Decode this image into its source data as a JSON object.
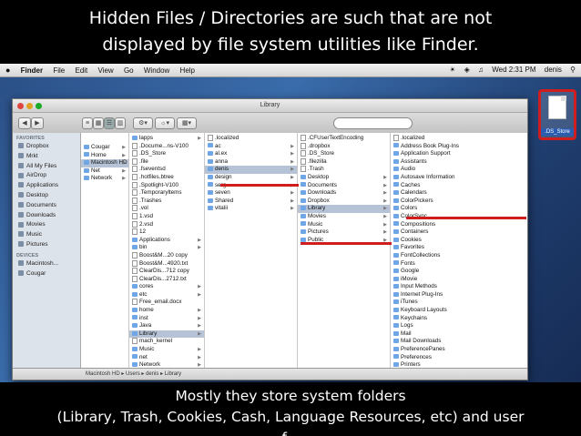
{
  "slide": {
    "title_line1": "Hidden Files / Directories are such that are not",
    "title_line2": "displayed by file system utilities like Finder.",
    "footer_line1": "Mostly they store system folders",
    "footer_line2": "(Library, Trash, Cookies, Cash, Language Resources, etc) and user",
    "footer_line3": "f..."
  },
  "menubar": {
    "apple": "",
    "items": [
      "Finder",
      "File",
      "Edit",
      "View",
      "Go",
      "Window",
      "Help"
    ],
    "clock": "Wed 2:31 PM",
    "user": "denis"
  },
  "desktop_file": {
    "label": ".DS_Store"
  },
  "window": {
    "title": "Library",
    "search_placeholder": "",
    "view_buttons": [
      "≡",
      "▦",
      "☰",
      "▥"
    ],
    "path": [
      "Macintosh HD",
      "Users",
      "denis",
      "Library"
    ]
  },
  "sidebar": {
    "favorites_header": "FAVORITES",
    "favorites": [
      "Dropbox",
      "Mrkt",
      "All My Files",
      "AirDrop",
      "Applications",
      "Desktop",
      "Documents",
      "Downloads",
      "Movies",
      "Music",
      "Pictures"
    ],
    "devices_header": "DEVICES",
    "devices": [
      "Macintosh...",
      "Cougar"
    ]
  },
  "columns": {
    "col1": [
      "Cougar",
      "Home",
      "Macintosh HD",
      "Net",
      "Network"
    ],
    "col2": [
      "lapps",
      ".Docume...ns-V100",
      ".DS_Store",
      ".file",
      ".fseventsd",
      ".hotfiles.btree",
      ".Spotlight-V100",
      ".Temporaryltems",
      ".Trashes",
      ".vol",
      "1.vsd",
      "2.vsd",
      "12",
      "Applications",
      "bin",
      "Boost&M...20 copy",
      "Boost&M...4920.txt",
      "ClearDis...712 copy",
      "ClearDis...2712.txt",
      "cores",
      "etc",
      "Free_email.docx",
      "home",
      "inst",
      "Java",
      "Library",
      "mach_kernel",
      "Music",
      "net",
      "Network"
    ],
    "col3": [
      ".localized",
      "ac",
      "al.ex",
      "anna",
      "denis",
      "design",
      "serg",
      "seven",
      "Shared",
      "vitalii"
    ],
    "col4": [
      ".CFUserTextEncoding",
      ".dropbox",
      ".DS_Store",
      ".filezilla",
      ".Trash",
      "Desktop",
      "Documents",
      "Downloads",
      "Dropbox",
      "Library",
      "Movies",
      "Music",
      "Pictures",
      "Public"
    ],
    "col5": [
      ".localized",
      "Address Book Plug-Ins",
      "Application Support",
      "Assistants",
      "Audio",
      "Autosave Information",
      "Caches",
      "Calendars",
      "ColorPickers",
      "Colors",
      "ColorSync",
      "Compositions",
      "Containers",
      "Cookies",
      "Favorites",
      "FontCollections",
      "Fonts",
      "Google",
      "iMovie",
      "Input Methods",
      "Internet Plug-Ins",
      "iTunes",
      "Keyboard Layouts",
      "Keychains",
      "Logs",
      "Mail",
      "Mail Downloads",
      "PreferencePanes",
      "Preferences",
      "Printers"
    ]
  },
  "colors": {
    "highlight": "#d01e1e",
    "selection": "#b6c3d6"
  }
}
